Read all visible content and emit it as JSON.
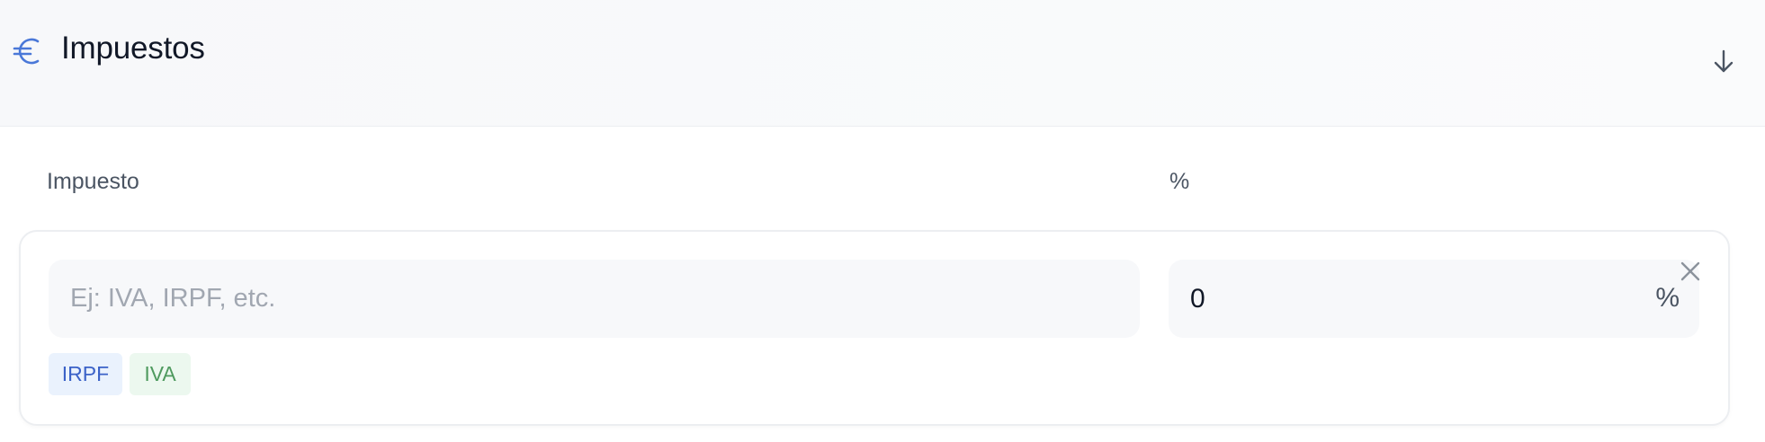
{
  "section": {
    "title": "Impuestos",
    "icon": "euro-icon",
    "toggle_icon": "arrow-down-icon",
    "accent_color": "#4a78d8"
  },
  "table": {
    "columns": [
      "Impuesto",
      "%"
    ]
  },
  "row": {
    "name_value": "",
    "name_placeholder": "Ej: IVA, IRPF, etc.",
    "percent_value": "0",
    "percent_suffix": "%",
    "remove_icon": "close-icon"
  },
  "suggestions": [
    {
      "label": "IRPF",
      "color": "#3b62c8"
    },
    {
      "label": "IVA",
      "color": "#4e9a5e"
    }
  ]
}
